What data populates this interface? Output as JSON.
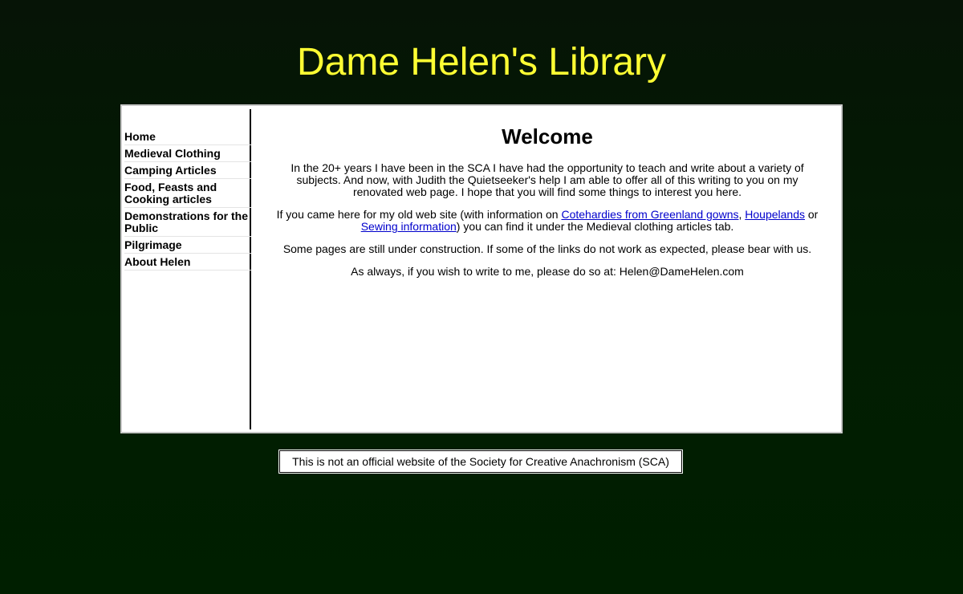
{
  "site_title": "Dame Helen's Library",
  "nav": {
    "items": [
      {
        "label": "Home"
      },
      {
        "label": "Medieval Clothing"
      },
      {
        "label": "Camping Articles"
      },
      {
        "label": "Food, Feasts and Cooking articles"
      },
      {
        "label": "Demonstrations for the Public"
      },
      {
        "label": "Pilgrimage"
      },
      {
        "label": "About Helen"
      }
    ]
  },
  "content": {
    "heading": "Welcome",
    "para1": "In the 20+ years I have been in the SCA I have had the opportunity to teach and write about a variety of subjects. And now, with Judith the Quietseeker's help I am able to offer all of this writing to you on my renovated web page. I hope that you will find some things to interest you here.",
    "para2_prefix": "If you came here for my old web site (with information on ",
    "link_cotehardies": "Cotehardies from Greenland gowns",
    "sep1": ", ",
    "link_houpelands": "Houpelands",
    "sep2": " or ",
    "link_sewing": "Sewing information",
    "para2_suffix": ") you can find it under the Medieval clothing articles tab.",
    "para3": "Some pages are still under construction. If some of the links do not work as expected, please bear with us.",
    "para4": "As always, if you wish to write to me, please do so at: Helen@DameHelen.com"
  },
  "footer": {
    "notice": "This is not an official website of the Society for Creative Anachronism (SCA)"
  },
  "colors": {
    "title": "#ffff33",
    "link": "#0000cc",
    "background": "#021d02"
  }
}
